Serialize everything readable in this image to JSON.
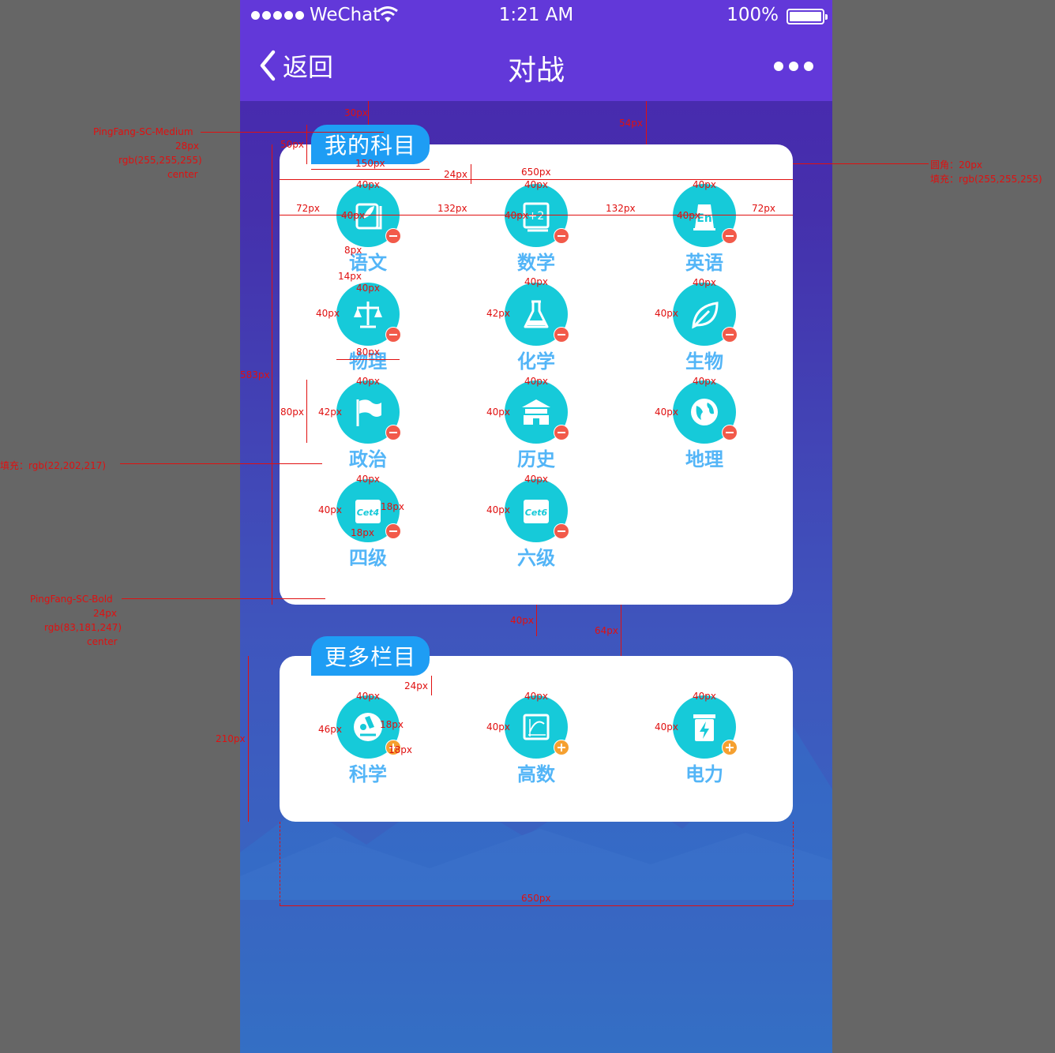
{
  "status_bar": {
    "carrier": "WeChat",
    "time": "1:21 AM",
    "battery": "100%"
  },
  "nav": {
    "back_label": "返回",
    "title": "对战"
  },
  "my_subjects": {
    "title": "我的科目",
    "items": [
      {
        "label": "语文",
        "icon": "book-leaf-icon",
        "badge": "remove"
      },
      {
        "label": "数学",
        "icon": "math-formula-icon",
        "badge": "remove"
      },
      {
        "label": "英语",
        "icon": "english-book-icon",
        "badge": "remove"
      },
      {
        "label": "物理",
        "icon": "scales-icon",
        "badge": "remove"
      },
      {
        "label": "化学",
        "icon": "flask-icon",
        "badge": "remove"
      },
      {
        "label": "生物",
        "icon": "leaf-icon",
        "badge": "remove"
      },
      {
        "label": "政治",
        "icon": "flag-icon",
        "badge": "remove"
      },
      {
        "label": "历史",
        "icon": "temple-icon",
        "badge": "remove"
      },
      {
        "label": "地理",
        "icon": "globe-icon",
        "badge": "remove"
      },
      {
        "label": "四级",
        "icon": "cet4-icon",
        "icon_text": "Cet4",
        "badge": "remove"
      },
      {
        "label": "六级",
        "icon": "cet6-icon",
        "icon_text": "Cet6",
        "badge": "remove"
      }
    ]
  },
  "more_subjects": {
    "title": "更多栏目",
    "items": [
      {
        "label": "科学",
        "icon": "microscope-icon",
        "badge": "add"
      },
      {
        "label": "高数",
        "icon": "graph-icon",
        "badge": "add"
      },
      {
        "label": "电力",
        "icon": "lightning-icon",
        "badge": "add"
      }
    ]
  },
  "colors": {
    "header": "#6238d9",
    "pill": "#1e9df4",
    "icon_fill": "#16cad9",
    "label": "#53b5f7",
    "remove_badge": "#f25a4a",
    "add_badge": "#f5a030"
  },
  "annotations": {
    "title_font": "PingFang-SC-Medium",
    "title_size": "28px",
    "title_color": "rgb(255,255,255)",
    "title_align": "center",
    "m30": "30px",
    "m54": "54px",
    "h50": "50px",
    "w150": "150px",
    "g24": "24px",
    "w650": "650px",
    "radius": "圆角：20px",
    "fill_white": "填充：rgb(255,255,255)",
    "i40": "40px",
    "m72": "72px",
    "g132": "132px",
    "g8": "8px",
    "g14": "14px",
    "h42": "42px",
    "w80": "80px",
    "h80": "80px",
    "h583": "583px",
    "fill_cyan": "填充：rgb(22,202,217)",
    "s18": "18px",
    "label_font": "PingFang-SC-Bold",
    "label_size": "24px",
    "label_color": "rgb(83,181,247)",
    "label_align": "center",
    "g40": "40px",
    "g64": "64px",
    "h210": "210px",
    "h46": "46px"
  }
}
